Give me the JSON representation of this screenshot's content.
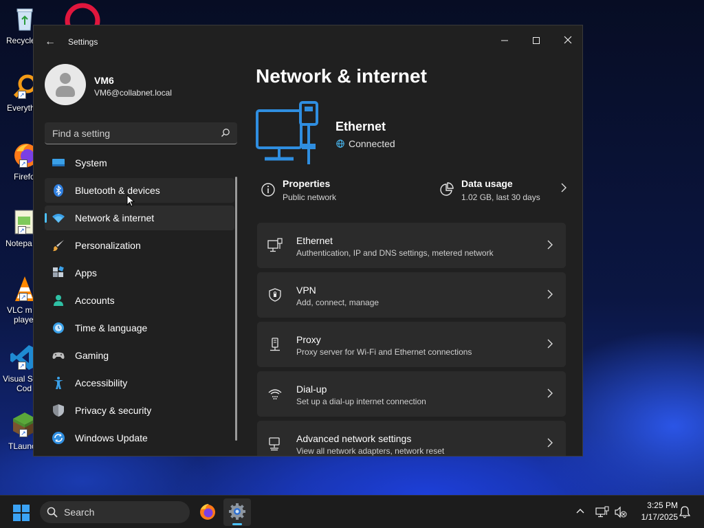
{
  "desktop": {
    "icons": [
      {
        "label": "Recycle",
        "icon": "recycle-bin-icon"
      },
      {
        "label": "",
        "icon": "opera-icon"
      },
      {
        "label": "Everyth",
        "icon": "everything-search-icon"
      },
      {
        "label": "Firefo",
        "icon": "firefox-icon"
      },
      {
        "label": "Notepa",
        "icon": "notepad-icon"
      },
      {
        "label": "VLC m",
        "label2": "playe",
        "icon": "vlc-icon"
      },
      {
        "label": "Visual St",
        "label2": "Cod",
        "icon": "vscode-icon"
      },
      {
        "label": "TLaunc",
        "icon": "minecraft-grass-icon"
      }
    ]
  },
  "window": {
    "title": "Settings",
    "minimize_glyph": "—",
    "maximize_glyph": "☐",
    "close_glyph": "✕",
    "back_glyph": "←"
  },
  "user": {
    "name": "VM6",
    "email": "VM6@collabnet.local"
  },
  "search": {
    "placeholder": "Find a setting",
    "value": ""
  },
  "nav": {
    "items": [
      {
        "label": "System",
        "icon": "system-display-icon"
      },
      {
        "label": "Bluetooth & devices",
        "icon": "bluetooth-icon"
      },
      {
        "label": "Network & internet",
        "icon": "wifi-icon"
      },
      {
        "label": "Personalization",
        "icon": "paintbrush-icon"
      },
      {
        "label": "Apps",
        "icon": "apps-icon"
      },
      {
        "label": "Accounts",
        "icon": "accounts-icon"
      },
      {
        "label": "Time & language",
        "icon": "time-language-icon"
      },
      {
        "label": "Gaming",
        "icon": "gamepad-icon"
      },
      {
        "label": "Accessibility",
        "icon": "accessibility-icon"
      },
      {
        "label": "Privacy & security",
        "icon": "shield-icon"
      },
      {
        "label": "Windows Update",
        "icon": "windows-update-icon"
      }
    ],
    "active_index": 2,
    "hover_index": 1
  },
  "main": {
    "title": "Network & internet",
    "hero": {
      "name": "Ethernet",
      "status": "Connected"
    },
    "properties": {
      "title": "Properties",
      "subtitle": "Public network"
    },
    "data_usage": {
      "title": "Data usage",
      "subtitle": "1.02 GB, last 30 days"
    },
    "cards": [
      {
        "title": "Ethernet",
        "subtitle": "Authentication, IP and DNS settings, metered network",
        "icon": "ethernet-icon"
      },
      {
        "title": "VPN",
        "subtitle": "Add, connect, manage",
        "icon": "vpn-shield-icon"
      },
      {
        "title": "Proxy",
        "subtitle": "Proxy server for Wi-Fi and Ethernet connections",
        "icon": "proxy-icon"
      },
      {
        "title": "Dial-up",
        "subtitle": "Set up a dial-up internet connection",
        "icon": "dialup-icon"
      },
      {
        "title": "Advanced network settings",
        "subtitle": "View all network adapters, network reset",
        "icon": "advanced-network-icon"
      }
    ]
  },
  "taskbar": {
    "search_label": "Search",
    "time": "3:25 PM",
    "date": "1/17/2025"
  },
  "colors": {
    "accent": "#4cc2ff",
    "window_bg": "#202020",
    "card_bg": "#2b2b2b",
    "hero_icon": "#2f8ee0"
  }
}
